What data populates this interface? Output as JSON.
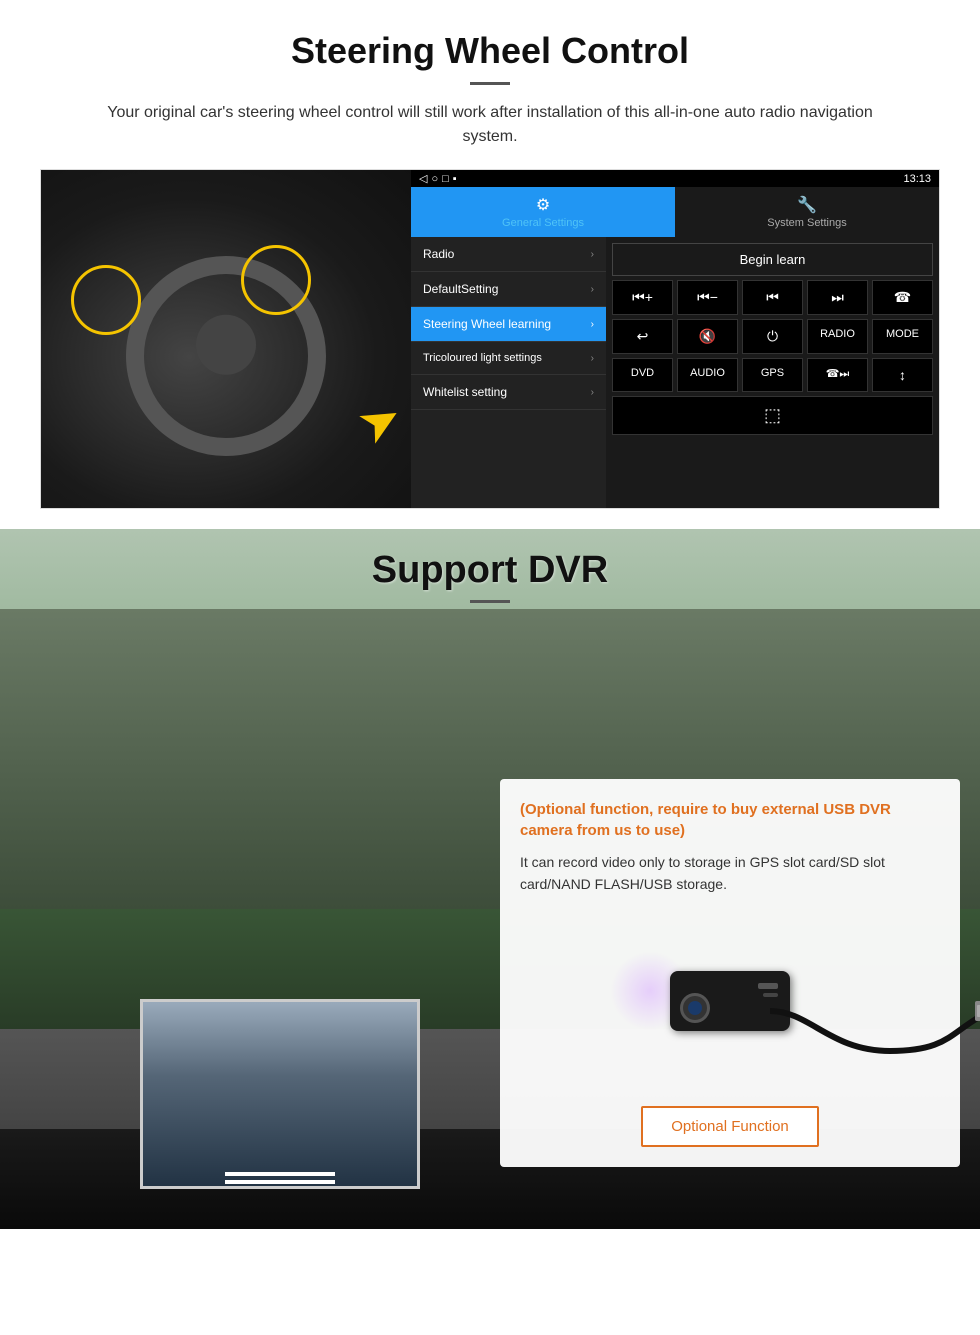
{
  "steering": {
    "title": "Steering Wheel Control",
    "subtitle": "Your original car's steering wheel control will still work after installation of this all-in-one auto radio navigation system.",
    "statusbar": {
      "time": "13:13",
      "icons": "▼ ▼"
    },
    "tabs": [
      {
        "label": "General Settings",
        "icon": "⚙",
        "active": true
      },
      {
        "label": "System Settings",
        "icon": "🔧",
        "active": false
      }
    ],
    "menu": [
      {
        "label": "Radio",
        "active": false
      },
      {
        "label": "DefaultSetting",
        "active": false
      },
      {
        "label": "Steering Wheel learning",
        "active": true
      },
      {
        "label": "Tricoloured light settings",
        "active": false
      },
      {
        "label": "Whitelist setting",
        "active": false
      }
    ],
    "begin_learn": "Begin learn",
    "buttons": [
      [
        "⏮+",
        "⏮−",
        "⏭",
        "⏭|",
        "📞"
      ],
      [
        "↩",
        "🔇",
        "⏻",
        "RADIO",
        "MODE"
      ],
      [
        "DVD",
        "AUDIO",
        "GPS",
        "📞⏭",
        "↕⏭"
      ],
      [
        "⬜"
      ]
    ]
  },
  "dvr": {
    "title": "Support DVR",
    "optional_note": "(Optional function, require to buy external USB DVR camera from us to use)",
    "description": "It can record video only to storage in GPS slot card/SD slot card/NAND FLASH/USB storage.",
    "button_label": "Optional Function"
  }
}
